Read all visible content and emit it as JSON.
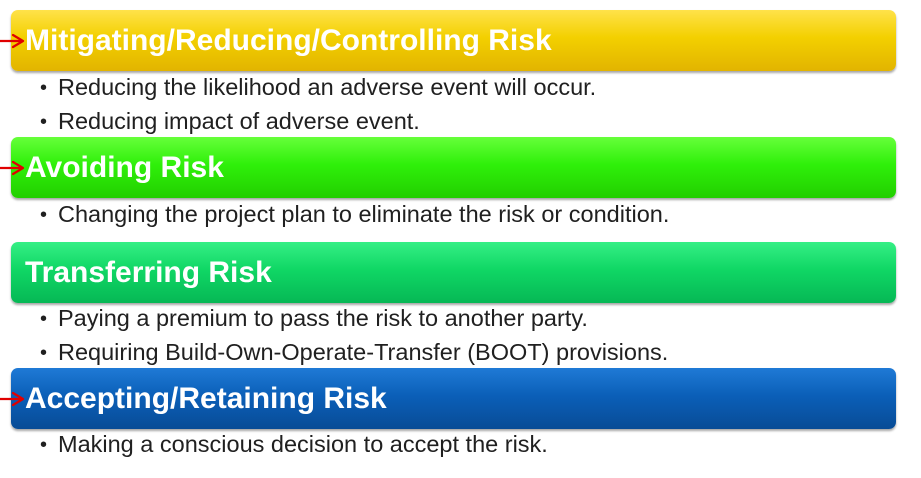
{
  "sections": [
    {
      "title": "Mitigating/Reducing/Controlling Risk",
      "color": "#f3d000",
      "items": [
        "Reducing the likelihood an adverse event will occur.",
        "Reducing impact of adverse event."
      ]
    },
    {
      "title": "Avoiding Risk",
      "color": "#2ff00a",
      "items": [
        "Changing the project plan to eliminate the risk or condition."
      ]
    },
    {
      "title": "Transferring Risk",
      "color": "#10d765",
      "items": [
        "Paying a premium to pass the risk to another party.",
        "Requiring Build-Own-Operate-Transfer (BOOT) provisions."
      ]
    },
    {
      "title": "Accepting/Retaining Risk",
      "color": "#0b5fb8",
      "items": [
        "Making a conscious decision to accept the risk."
      ]
    }
  ],
  "annotation_color": "#e00000"
}
